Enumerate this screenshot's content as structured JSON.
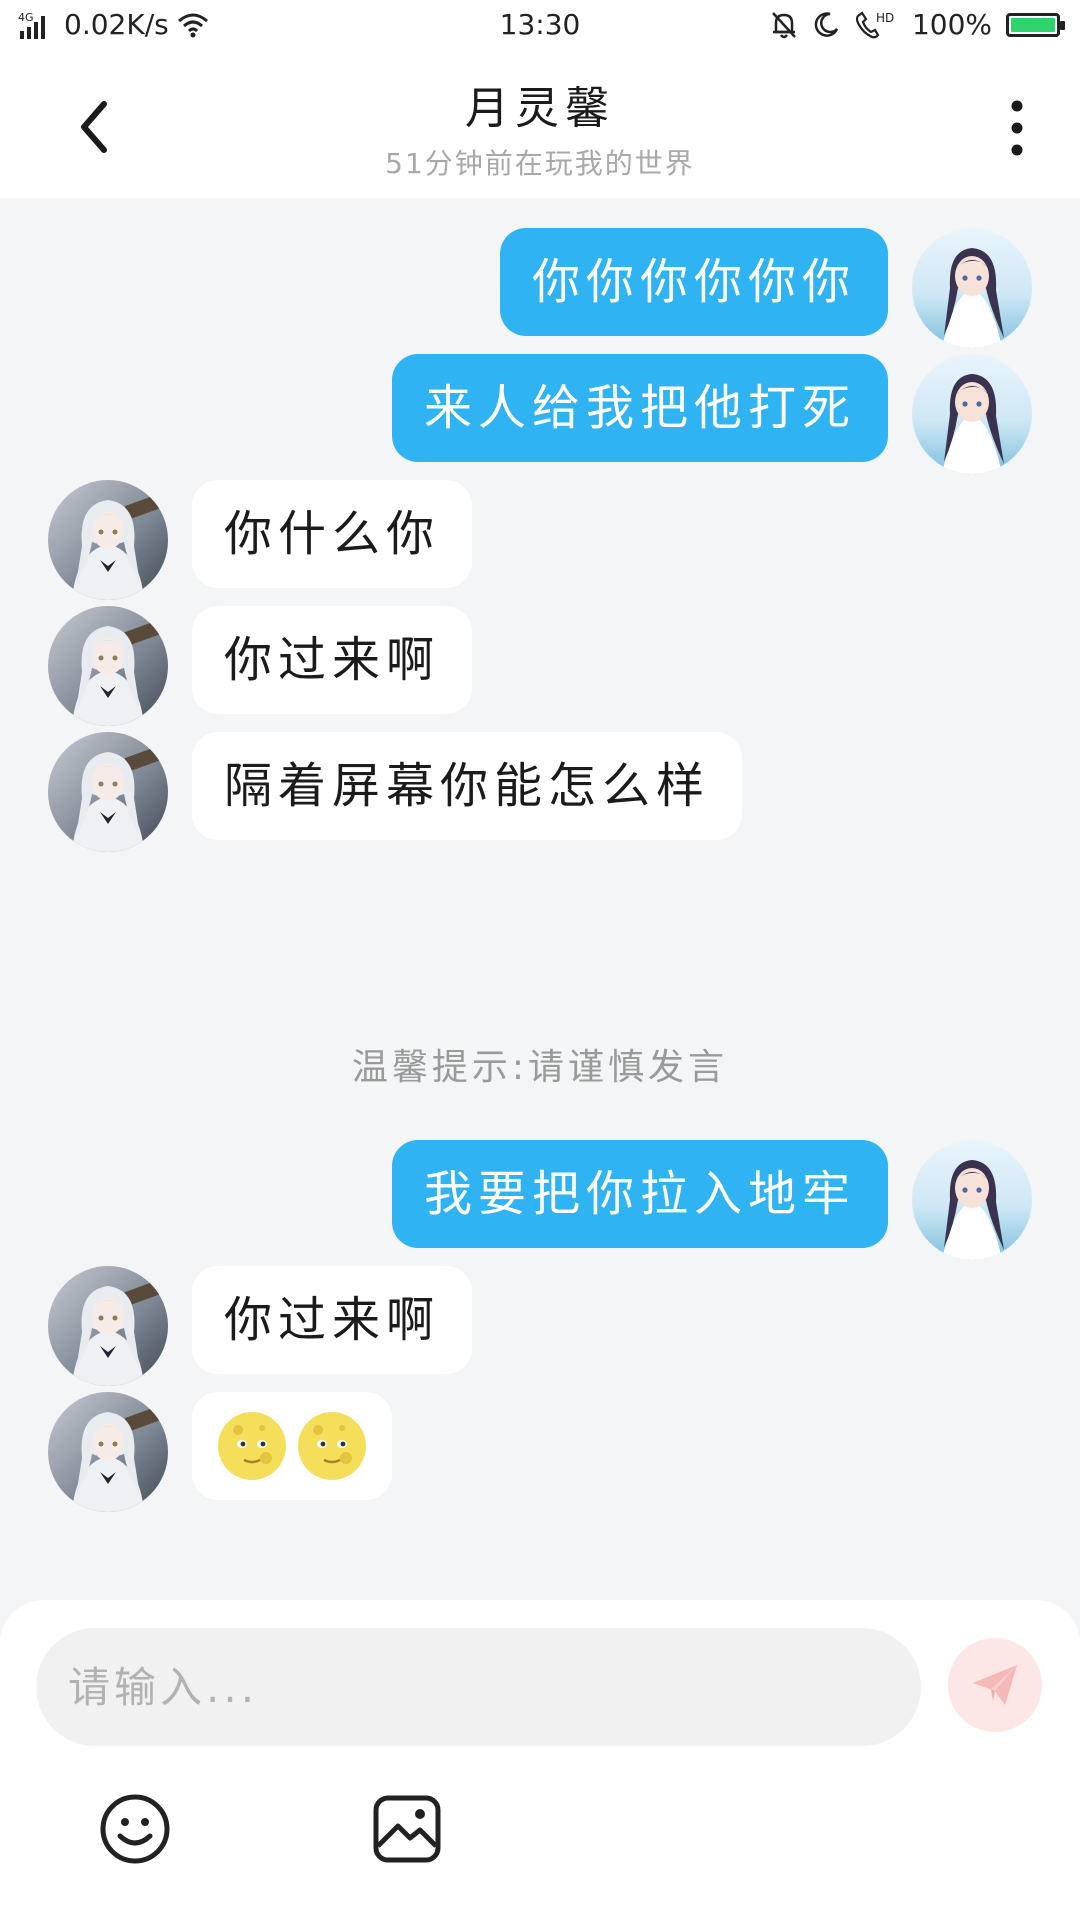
{
  "status_bar": {
    "network": "4G",
    "speed": "0.02K/s",
    "time": "13:30",
    "hd_label": "HD",
    "battery": "100%",
    "battery_color": "#2ed46b"
  },
  "header": {
    "title": "月灵馨",
    "subtitle": "51分钟前在玩我的世界",
    "back_icon": "chevron-left-icon",
    "more_icon": "more-vertical-icon"
  },
  "colors": {
    "my_bubble": "#2fb3f2",
    "other_bubble": "#ffffff",
    "background": "#f3f5f7",
    "send_button": "#fde6e6"
  },
  "messages": [
    {
      "sender": "me",
      "text": "你你你你你你"
    },
    {
      "sender": "me",
      "text": "来人给我把他打死"
    },
    {
      "sender": "other",
      "text": "你什么你"
    },
    {
      "sender": "other",
      "text": "你过来啊"
    },
    {
      "sender": "other",
      "text": "隔着屏幕你能怎么样"
    },
    {
      "sender": "me",
      "text": "我要把你拉入地牢"
    },
    {
      "sender": "other",
      "text": "你过来啊"
    },
    {
      "sender": "other",
      "emoji": [
        "full-moon-face",
        "full-moon-face"
      ]
    }
  ],
  "system_notice": "温馨提示:请谨慎发言",
  "input": {
    "placeholder": "请输入...",
    "value": ""
  },
  "toolbar": {
    "send_icon": "paper-plane-icon",
    "emoji_icon": "smiley-icon",
    "image_icon": "image-icon"
  }
}
